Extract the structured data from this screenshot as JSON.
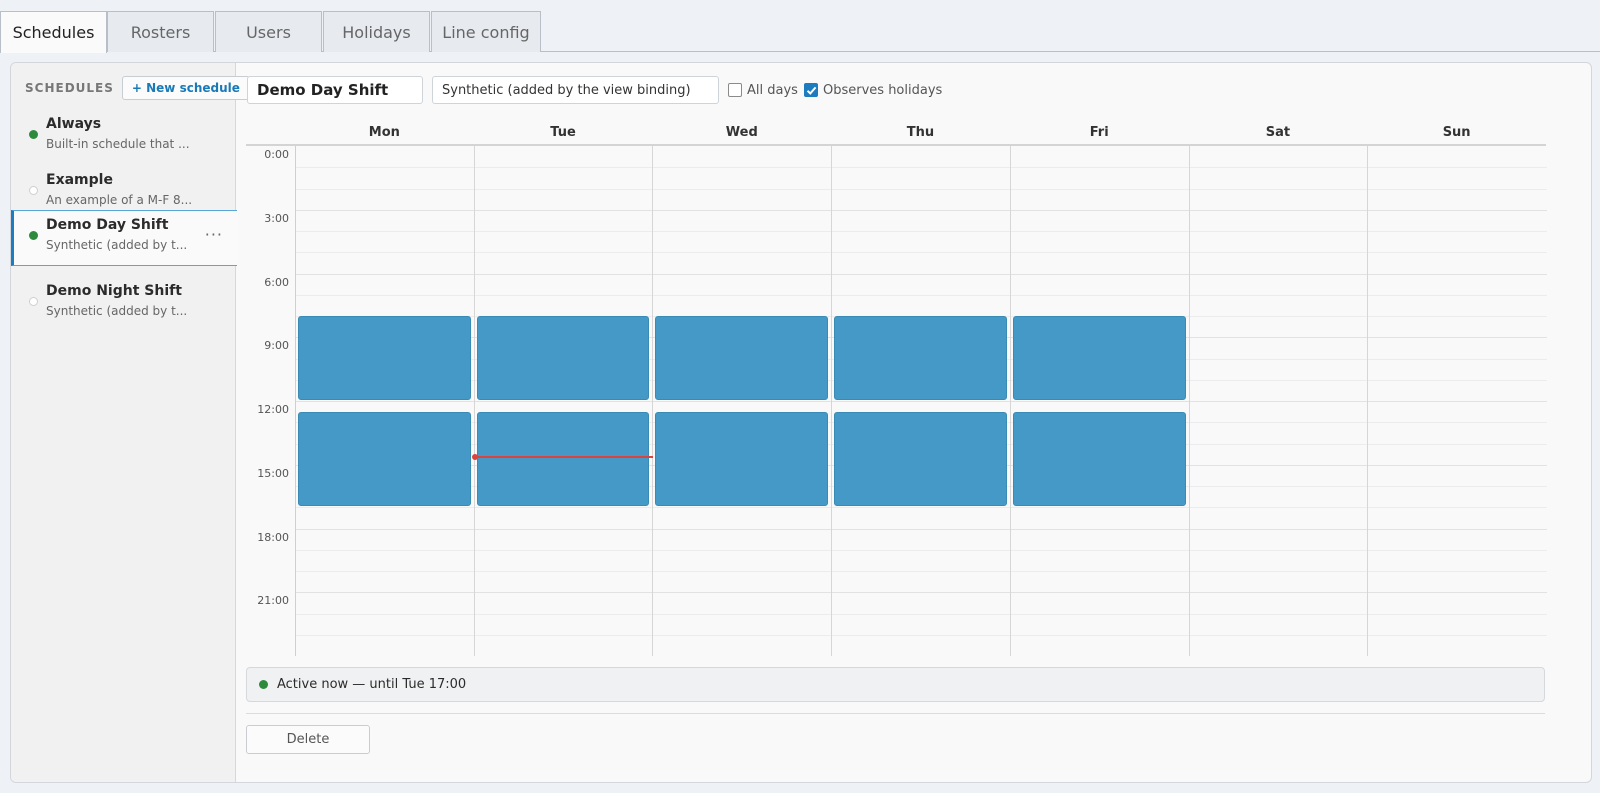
{
  "tabs": [
    {
      "label": "Schedules",
      "active": true
    },
    {
      "label": "Rosters",
      "active": false
    },
    {
      "label": "Users",
      "active": false
    },
    {
      "label": "Holidays",
      "active": false
    },
    {
      "label": "Line config",
      "active": false
    }
  ],
  "sidebar": {
    "title": "SCHEDULES",
    "new_button": "+ New schedule",
    "items": [
      {
        "name": "Always",
        "desc": "Built-in schedule that ...",
        "active": true,
        "selected": false
      },
      {
        "name": "Example",
        "desc": "An example of a M-F 8...",
        "active": false,
        "selected": false
      },
      {
        "name": "Demo Day Shift",
        "desc": "Synthetic (added by t...",
        "active": true,
        "selected": true,
        "menu": "···"
      },
      {
        "name": "Demo Night Shift",
        "desc": "Synthetic (added by t...",
        "active": false,
        "selected": false
      }
    ]
  },
  "editor": {
    "name_value": "Demo Day Shift",
    "desc_value": "Synthetic (added by the view binding)",
    "all_days_label": "All days",
    "all_days_checked": false,
    "observes_holidays_label": "Observes holidays",
    "observes_holidays_checked": true
  },
  "calendar": {
    "days": [
      "Mon",
      "Tue",
      "Wed",
      "Thu",
      "Fri",
      "Sat",
      "Sun"
    ],
    "time_labels": [
      "0:00",
      "3:00",
      "6:00",
      "9:00",
      "12:00",
      "15:00",
      "18:00",
      "21:00"
    ],
    "blocks": [
      {
        "day": 0,
        "start": "08:00",
        "end": "12:00"
      },
      {
        "day": 1,
        "start": "08:00",
        "end": "12:00"
      },
      {
        "day": 2,
        "start": "08:00",
        "end": "12:00"
      },
      {
        "day": 3,
        "start": "08:00",
        "end": "12:00"
      },
      {
        "day": 4,
        "start": "08:00",
        "end": "12:00"
      },
      {
        "day": 0,
        "start": "12:30",
        "end": "17:00"
      },
      {
        "day": 1,
        "start": "12:30",
        "end": "17:00"
      },
      {
        "day": 2,
        "start": "12:30",
        "end": "17:00"
      },
      {
        "day": 3,
        "start": "12:30",
        "end": "17:00"
      },
      {
        "day": 4,
        "start": "12:30",
        "end": "17:00"
      }
    ],
    "now": {
      "day": 1,
      "time": "14:35"
    },
    "colors": {
      "block": "#4599c6",
      "now_line": "#d9443f",
      "accent": "#1d7bbf",
      "active_dot": "#2e8b3e"
    }
  },
  "status": {
    "text": "Active now — until Tue 17:00"
  },
  "delete_label": "Delete"
}
